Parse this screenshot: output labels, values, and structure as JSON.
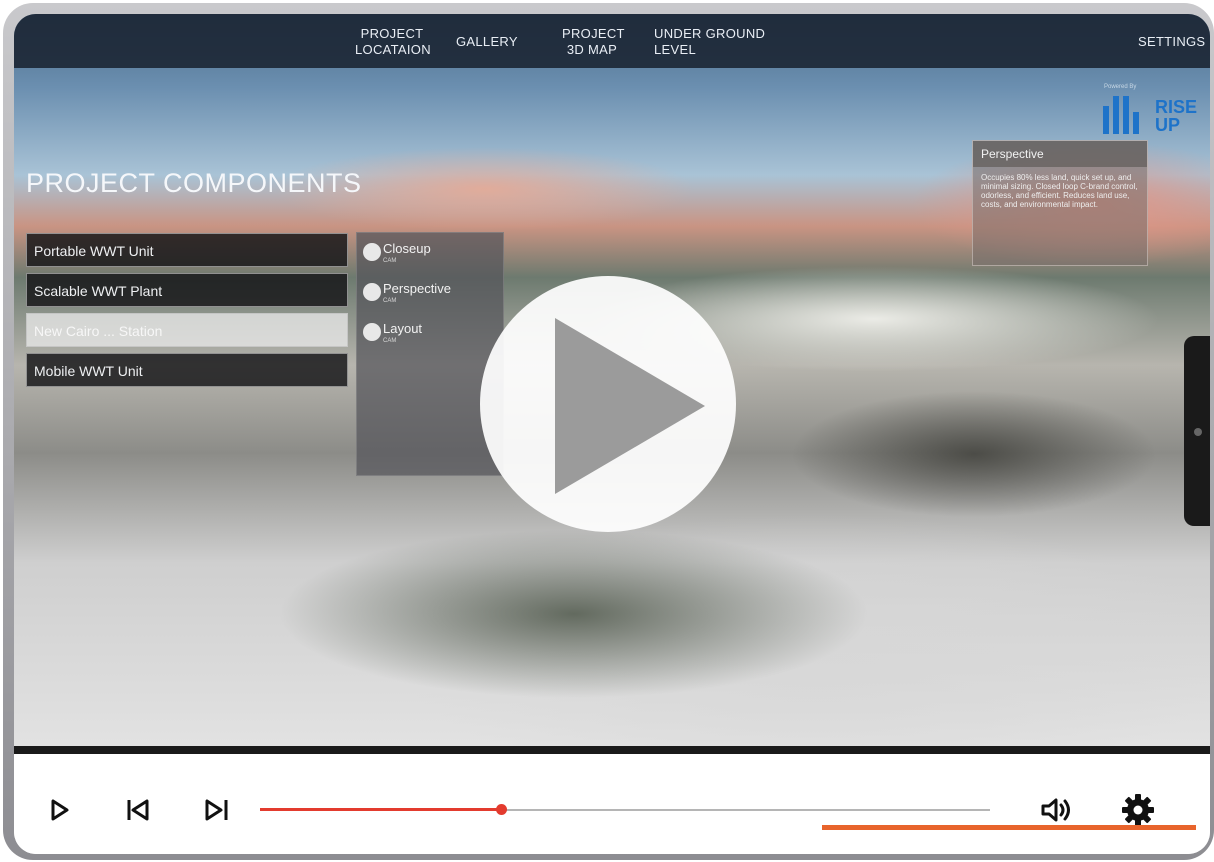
{
  "nav": {
    "items": [
      {
        "label": "PROJECT\nLOCATAION"
      },
      {
        "label": "GALLERY"
      },
      {
        "label": "PROJECT\n3D MAP"
      },
      {
        "label": "UNDER GROUND\nLEVEL"
      },
      {
        "label": "SETTINGS"
      }
    ]
  },
  "logo": {
    "powered": "Powered By",
    "text_line1": "RISE",
    "text_line2": "UP"
  },
  "heading": "PROJECT COMPONENTS",
  "components": [
    {
      "label": "Portable WWT Unit",
      "selected": false
    },
    {
      "label": "Scalable WWT Plant",
      "selected": false
    },
    {
      "label": "New Cairo ... Station",
      "selected": true
    },
    {
      "label": "Mobile WWT Unit",
      "selected": false
    }
  ],
  "cameras": [
    {
      "label": "Closeup",
      "sub": "CAM"
    },
    {
      "label": "Perspective",
      "sub": "CAM"
    },
    {
      "label": "Layout",
      "sub": "CAM"
    }
  ],
  "perspective_panel": {
    "title": "Perspective",
    "body": "Occupies 80% less land, quick set up, and minimal sizing. Closed loop C-brand control, odorless, and efficient. Reduces land use, costs, and environmental impact."
  },
  "player": {
    "progress": 0.33,
    "icons": [
      "play-icon",
      "skip-back-icon",
      "skip-forward-icon",
      "volume-icon",
      "gear-icon"
    ],
    "accent_color": "#e33b2e"
  }
}
